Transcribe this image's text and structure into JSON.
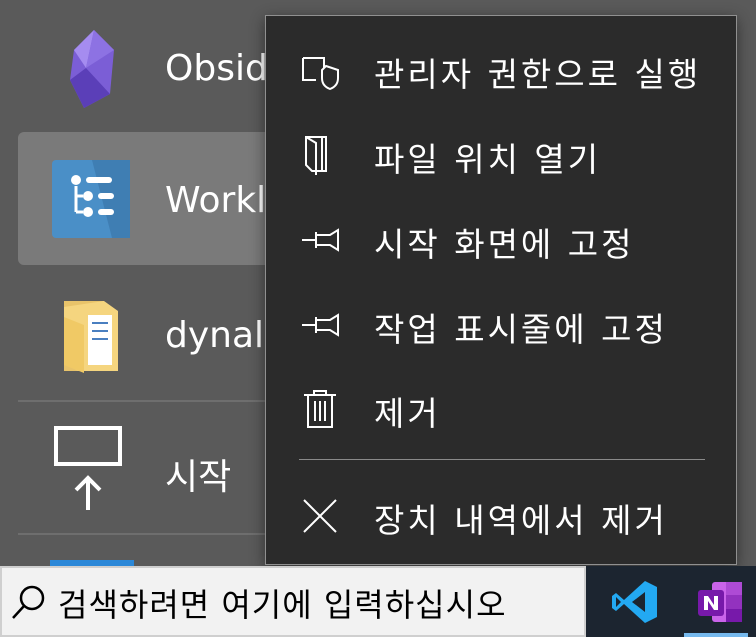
{
  "apps": [
    {
      "label": "Obsid",
      "icon": "obsidian-icon"
    },
    {
      "label": "Workl",
      "icon": "workflowy-icon",
      "selected": true
    },
    {
      "label": "dynali",
      "icon": "folder-icon"
    },
    {
      "label": "시작 ",
      "icon": "start-upload-icon"
    }
  ],
  "context_menu": {
    "items": [
      {
        "label": "관리자 권한으로 실행",
        "icon": "shield-icon"
      },
      {
        "label": "파일 위치 열기",
        "icon": "open-folder-icon"
      },
      {
        "label": "시작 화면에 고정",
        "icon": "pin-icon"
      },
      {
        "label": "작업 표시줄에 고정",
        "icon": "pin-icon"
      },
      {
        "label": "제거",
        "icon": "trash-icon"
      },
      {
        "label": "장치 내역에서 제거",
        "icon": "close-icon"
      }
    ]
  },
  "taskbar": {
    "search_placeholder": "검색하려면 여기에 입력하십시오",
    "apps": [
      {
        "name": "vscode-icon",
        "color": "#23a9f2"
      },
      {
        "name": "onenote-icon",
        "color": "#7719aa",
        "active": true
      }
    ]
  },
  "colors": {
    "menu_bg": "#2b2b2b",
    "accent": "#2b88d8"
  }
}
